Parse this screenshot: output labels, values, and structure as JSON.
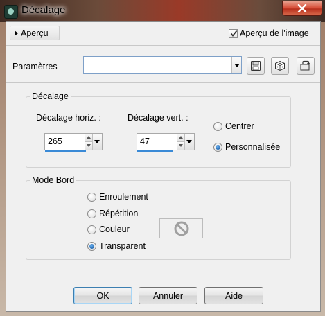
{
  "window": {
    "title": "Décalage",
    "app_icon": "paintshop-icon",
    "close_icon": "close-icon"
  },
  "toolbar": {
    "apercu_label": "Aperçu",
    "apercu_image_label": "Aperçu de l'image",
    "apercu_image_checked": true
  },
  "parametres": {
    "label": "Paramètres",
    "value": "",
    "save_icon": "save-icon",
    "random_icon": "dice-icon",
    "reset_icon": "reset-icon"
  },
  "decalage": {
    "group_label": "Décalage",
    "horiz_label": "Décalage horiz. :",
    "horiz_value": "265",
    "horiz_fill": 0.72,
    "vert_label": "Décalage vert. :",
    "vert_value": "47",
    "vert_fill": 0.62,
    "centrer_label": "Centrer",
    "perso_label": "Personnalisée",
    "selected": "perso"
  },
  "mode_bord": {
    "group_label": "Mode Bord",
    "options": [
      "Enroulement",
      "Répétition",
      "Couleur",
      "Transparent"
    ],
    "selected": "Transparent",
    "swatch_icon": "no-color-icon"
  },
  "buttons": {
    "ok": "OK",
    "annuler": "Annuler",
    "aide": "Aide"
  },
  "colors": {
    "accent": "#3a8ad6",
    "close": "#c8412c"
  }
}
